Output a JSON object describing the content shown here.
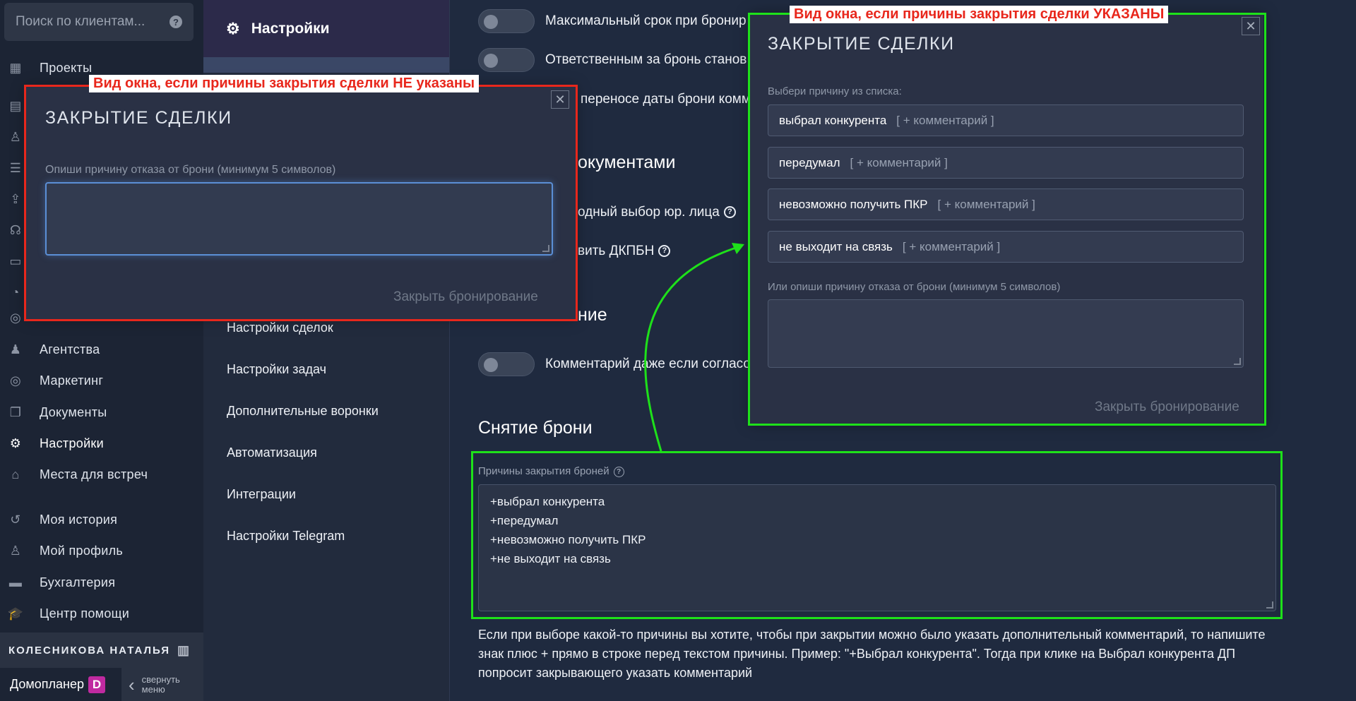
{
  "sidebar": {
    "search_placeholder": "Поиск по клиентам...",
    "nav": [
      {
        "label": "Проекты",
        "icon": "building-icon"
      },
      {
        "label": "Агентства",
        "icon": "agent-icon"
      },
      {
        "label": "Маркетинг",
        "icon": "target-icon"
      },
      {
        "label": "Документы",
        "icon": "documents-icon"
      },
      {
        "label": "Настройки",
        "icon": "gear-icon"
      },
      {
        "label": "Места для встреч",
        "icon": "meeting-place-icon"
      },
      {
        "label": "Моя история",
        "icon": "history-icon"
      },
      {
        "label": "Мой профиль",
        "icon": "profile-icon"
      },
      {
        "label": "Бухгалтерия",
        "icon": "accounting-icon"
      },
      {
        "label": "Центр помощи",
        "icon": "help-center-icon"
      }
    ],
    "user_name": "КОЛЕСНИКОВА НАТАЛЬЯ",
    "brand": "Домопланер",
    "brand_logo": "D",
    "collapse_line1": "свернуть",
    "collapse_line2": "меню"
  },
  "submenu": {
    "title": "Настройки",
    "items": [
      "Настройки сделок",
      "Настройки задач",
      "Дополнительные воронки",
      "Автоматизация",
      "Интеграции",
      "Настройки Telegram"
    ]
  },
  "main": {
    "options": [
      "Максимальный срок при бронир",
      "Ответственным за бронь станов",
      "переносе даты брони комме",
      "одный выбор юр. лица",
      "вить ДКПБН",
      "Комментарий даже если согласо"
    ],
    "section_docs": "окументами",
    "section_mid": "ние",
    "section_unbook": "Снятие брони",
    "reasons_label": "Причины закрытия броней",
    "reasons_lines": [
      "+выбрал конкурента",
      "+передумал",
      "+невозможно получить ПКР",
      "+не выходит на связь"
    ],
    "hint": "Если при выборе какой-то причины вы хотите, чтобы при закрытии можно было указать дополнительный комментарий, то напишите знак плюс + прямо в строке перед текстом причины. Пример: \"+Выбрал конкурента\". Тогда при клике на Выбрал конкурента ДП попросит закрывающего указать комментарий"
  },
  "annotations": {
    "red_label": "Вид окна, если причины закрытия сделки НЕ указаны",
    "green_label": "Вид окна, если причины закрытия сделки УКАЗАНЫ"
  },
  "modal_no_reasons": {
    "title": "ЗАКРЫТИЕ СДЕЛКИ",
    "label": "Опиши причину отказа от брони (минимум 5 символов)",
    "button": "Закрыть бронирование"
  },
  "modal_with_reasons": {
    "title": "ЗАКРЫТИЕ СДЕЛКИ",
    "choose_label": "Выбери причину из списка:",
    "reasons": [
      "выбрал конкурента",
      "передумал",
      "невозможно получить ПКР",
      "не выходит на связь"
    ],
    "comment_suffix": "[ + комментарий ]",
    "or_label": "Или опиши причину отказа от брони (минимум 5 символов)",
    "button": "Закрыть бронирование"
  },
  "colors": {
    "annotation_red": "#e8271c",
    "annotation_green": "#1ee11a",
    "brand_logo": "#c02aa0"
  }
}
